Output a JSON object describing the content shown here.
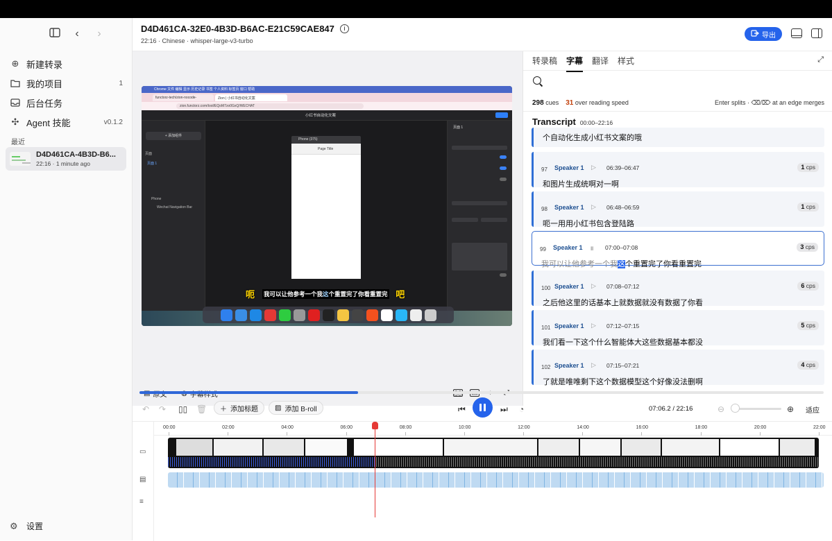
{
  "sidebar": {
    "items": [
      {
        "label": "新建转录",
        "icon": "plus-circle-icon",
        "count": ""
      },
      {
        "label": "我的项目",
        "icon": "folder-icon",
        "count": "1"
      },
      {
        "label": "后台任务",
        "icon": "inbox-icon",
        "count": ""
      },
      {
        "label": "Agent 技能",
        "icon": "puzzle-icon",
        "count": "v0.1.2"
      }
    ],
    "recent_label": "最近",
    "recent": {
      "title": "D4D461CA-4B3D-B6...",
      "subtitle": "22:16 · 1 minute ago"
    },
    "settings_label": "设置"
  },
  "header": {
    "title": "D4D461CA-32E0-4B3D-B6AC-E21C59CAE847",
    "subtitle": "22:16 · Chinese · whisper-large-v3-turbo",
    "export_label": "导出"
  },
  "video": {
    "subtitle_text": "我可以让他参考一个我这个重置完了你看重置完",
    "subtitle_highlight": "这",
    "subtitle_outer_left": "呃",
    "subtitle_outer_right": "吧",
    "browser": {
      "menu": "Chrome  文件  编辑  显示  历史记录  书签  个人资料  标签页  窗口  帮助",
      "tab1": "functorz-tech/zion-nocode-",
      "tab2": "Zion | 小红书自动化文案",
      "url": "zion.functorz.com/tool/EQoM7zo0GxQ/WECHAT",
      "app_title": "小红书自动化文案",
      "add_component": "+ 添加组件",
      "pages_label": "页面",
      "page1": "页面 1",
      "tree_phone": "Phone",
      "tree_nav": "Wechat Navigation Bar",
      "phone_caption": "Phone (375)",
      "phone_page_title": "Page Title",
      "right_title": "页面 1"
    },
    "controls": {
      "original": "原文",
      "subtitle_style": "字幕样式"
    }
  },
  "transcript": {
    "tabs": [
      "转录稿",
      "字幕",
      "翻译",
      "样式"
    ],
    "active_tab": "字幕",
    "stats": {
      "cues": "298",
      "cues_label": "cues",
      "over": "31",
      "over_label": "over reading speed"
    },
    "hint": "Enter splits · ⌫/⌦ at an edge merges",
    "heading": "Transcript",
    "range": "00:00–22:16",
    "first_text": "个自动化生成小红书文案的哦",
    "cues": [
      {
        "num": "97",
        "speaker": "Speaker 1",
        "time": "06:39–06:47",
        "cps": "1",
        "text": "和图片生成统啊对一啊"
      },
      {
        "num": "98",
        "speaker": "Speaker 1",
        "time": "06:48–06:59",
        "cps": "1",
        "text": "呃一用用小红书包含登陆路"
      },
      {
        "num": "99",
        "speaker": "Speaker 1",
        "time": "07:00–07:08",
        "cps": "3",
        "text_pre": "我可以让他参考一个我",
        "text_hl": "这",
        "text_post": "个重置完了你看重置完"
      },
      {
        "num": "100",
        "speaker": "Speaker 1",
        "time": "07:08–07:12",
        "cps": "6",
        "text": "之后他这里的话基本上就数据就没有数据了你看"
      },
      {
        "num": "101",
        "speaker": "Speaker 1",
        "time": "07:12–07:15",
        "cps": "5",
        "text": "我们看一下这个什么智能体大这些数据基本都没"
      },
      {
        "num": "102",
        "speaker": "Speaker 1",
        "time": "07:15–07:21",
        "cps": "4",
        "text": "了就是唯唯剩下这个数据模型这个好像没法删啊"
      }
    ],
    "cps_unit": "cps"
  },
  "player": {
    "add_title": "添加标题",
    "add_broll": "添加 B-roll",
    "timecode": "07:06.2 / 22:16",
    "fit": "适应",
    "progress": 0.319
  },
  "timeline": {
    "ticks": [
      "00:00",
      "02:00",
      "04:00",
      "06:00",
      "08:00",
      "10:00",
      "12:00",
      "14:00",
      "16:00",
      "18:00",
      "20:00",
      "22:00"
    ]
  },
  "colors": {
    "accent": "#2563eb",
    "warn": "#c2410c",
    "playhead": "#e53935"
  }
}
